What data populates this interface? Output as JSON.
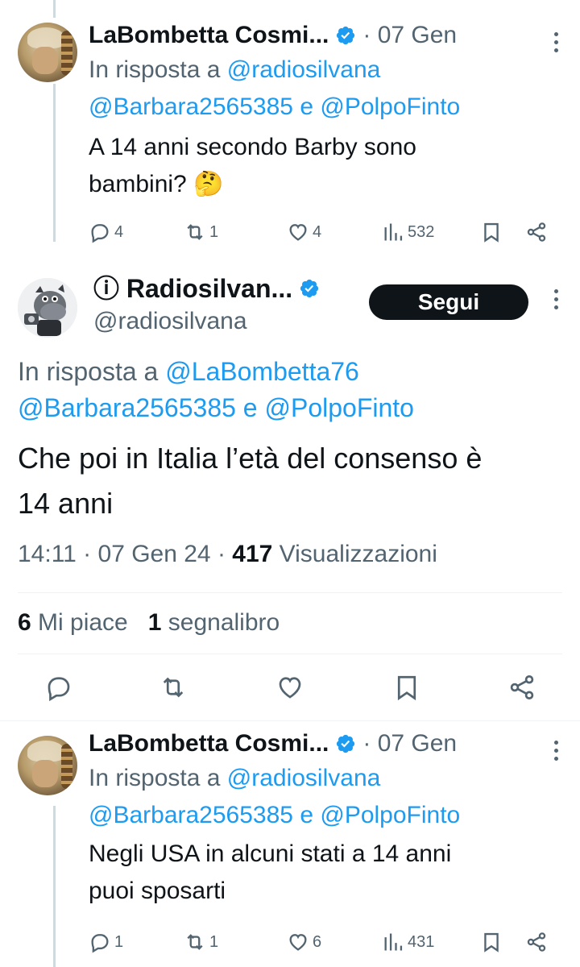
{
  "tweets": [
    {
      "name": "LaBombetta Cosmi...",
      "date": "· 07 Gen",
      "reply_to_prefix": "In risposta a",
      "reply_to_first": "@radiosilvana",
      "reply_to_second": "@Barbara2565385",
      "reply_and": "e",
      "reply_to_third": "@PolpoFinto",
      "text_line1": "A 14 anni secondo Barby sono",
      "text_line2": "bambini? 🤔",
      "replies": "4",
      "retweets": "1",
      "likes": "4",
      "views": "532"
    },
    {
      "name": "LaBombetta Cosmi...",
      "date": "· 07 Gen",
      "reply_to_prefix": "In risposta a",
      "reply_to_first": "@radiosilvana",
      "reply_to_second": "@Barbara2565385",
      "reply_and": "e",
      "reply_to_third": "@PolpoFinto",
      "text_line1": "Negli USA in alcuni stati a 14 anni",
      "text_line2": "puoi sposarti",
      "replies": "1",
      "retweets": "1",
      "likes": "6",
      "views": "431"
    }
  ],
  "main": {
    "name": "ⓘ Radiosilvan...",
    "handle": "@radiosilvana",
    "follow_label": "Segui",
    "reply_to_prefix": "In risposta a",
    "reply_to_first": "@LaBombetta76",
    "reply_to_second": "@Barbara2565385",
    "reply_and": "e",
    "reply_to_third": "@PolpoFinto",
    "text_line1": "Che poi in Italia l’età del consenso è",
    "text_line2": "14 anni",
    "time": "14:11 · 07 Gen 24 · ",
    "views_count": "417",
    "views_label": " Visualizzazioni",
    "likes_count": "6",
    "likes_label": " Mi piace",
    "bookmarks_count": "1",
    "bookmarks_label": " segnalibro"
  },
  "colors": {
    "link": "#1d9bf0",
    "muted": "#536471",
    "text": "#0f1419",
    "verified": "#1d9bf0",
    "follow_bg": "#0f1419"
  },
  "icons": [
    "reply-icon",
    "retweet-icon",
    "like-icon",
    "views-icon",
    "bookmark-icon",
    "share-icon",
    "verified-badge-icon",
    "more-icon"
  ]
}
